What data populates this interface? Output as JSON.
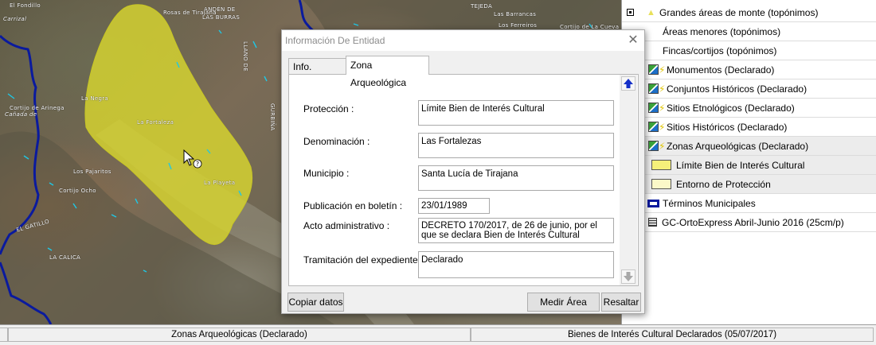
{
  "map": {
    "labels": [
      {
        "text": "El Fondillo"
      },
      {
        "text": "ANDÉN DE"
      },
      {
        "text": "LAS BURRAS"
      },
      {
        "text": "Carrizal"
      },
      {
        "text": "Rosas de Tirajana"
      },
      {
        "text": "La Negra"
      },
      {
        "text": "Cortijo de Arinega"
      },
      {
        "text": "TEJEDA"
      },
      {
        "text": "Los Ferreiros"
      },
      {
        "text": "Cortijo de La Cueva"
      },
      {
        "text": "Las Barrancas"
      },
      {
        "text": "Cortijo Ocho"
      },
      {
        "text": "Los Pajaritos"
      },
      {
        "text": "LLANO DE"
      },
      {
        "text": "EL GATILLO"
      },
      {
        "text": "LA CALICA"
      },
      {
        "text": "GURBIÑA"
      },
      {
        "text": "La Fortaleza"
      },
      {
        "text": "Cañada de"
      },
      {
        "text": "La Playeta"
      }
    ]
  },
  "legend": {
    "items": [
      {
        "label": "Grandes áreas de monte (topónimos)"
      },
      {
        "label": "Áreas menores (topónimos)"
      },
      {
        "label": "Fincas/cortijos (topónimos)"
      },
      {
        "label": "Monumentos (Declarado)"
      },
      {
        "label": "Conjuntos Históricos (Declarado)"
      },
      {
        "label": "Sitios Etnológicos (Declarado)"
      },
      {
        "label": "Sitios Históricos (Declarado)"
      },
      {
        "label": "Zonas Arqueológicas (Declarado)"
      },
      {
        "label": "Límite Bien de Interés Cultural"
      },
      {
        "label": "Entorno de Protección"
      },
      {
        "label": "Términos Municipales"
      },
      {
        "label": "GC-OrtoExpress Abril-Junio 2016 (25cm/p)"
      }
    ],
    "colors": {
      "bic_fill": "#f5f07a",
      "entorno_fill": "#fbf8c8",
      "municipal_border": "#0a1a9e"
    }
  },
  "dialog": {
    "title": "Información De Entidad",
    "close": "✕",
    "tabs": [
      {
        "label": "Info. General"
      },
      {
        "label": "Zona Arqueológica"
      }
    ],
    "fields": [
      {
        "label": "Protección :",
        "value": "Límite Bien de Interés Cultural"
      },
      {
        "label": "Denominación :",
        "value": "Las Fortalezas"
      },
      {
        "label": "Municipio :",
        "value": "Santa Lucía de Tirajana"
      },
      {
        "label": "Publicación en boletín :",
        "value": "23/01/1989"
      },
      {
        "label": "Acto administrativo :",
        "value": "DECRETO 170/2017, de 26 de junio, por el que se declara Bien de Interés Cultural"
      },
      {
        "label": "Tramitación del expediente :",
        "value": "Declarado"
      }
    ],
    "buttons": {
      "copy": "Copiar datos",
      "measure": "Medir Área",
      "highlight": "Resaltar"
    }
  },
  "status": {
    "layer": "Zonas Arqueológicas (Declarado)",
    "source": "Bienes de Interés Cultural Declarados (05/07/2017)"
  },
  "colors": {
    "polygon_fill": "#d8d630",
    "rivers": "#1d2bb0",
    "accent_blue": "#0a1a9e"
  }
}
